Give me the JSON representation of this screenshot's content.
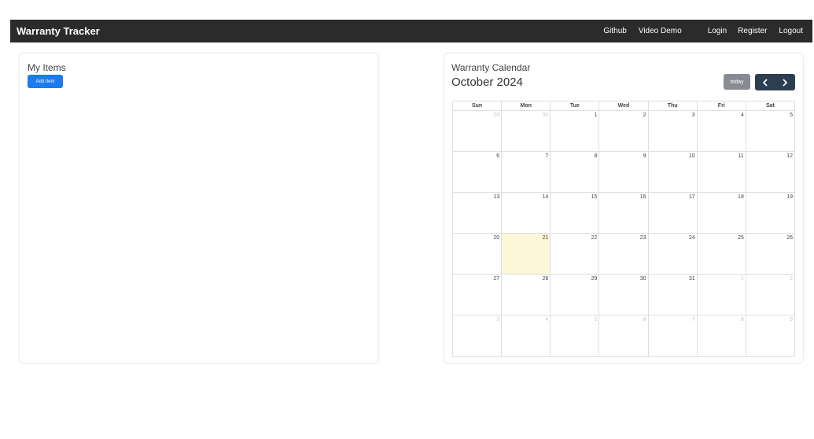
{
  "navbar": {
    "brand": "Warranty Tracker",
    "links": [
      "Github",
      "Video Demo",
      "Login",
      "Register",
      "Logout"
    ]
  },
  "items_panel": {
    "title": "My Items",
    "add_button": "Add Item"
  },
  "calendar": {
    "title": "Warranty Calendar",
    "month": "October 2024",
    "today_button": "today",
    "prev_icon": "chevron-left-icon",
    "next_icon": "chevron-right-icon",
    "days_of_week": [
      "Sun",
      "Mon",
      "Tue",
      "Wed",
      "Thu",
      "Fri",
      "Sat"
    ],
    "weeks": [
      [
        "29",
        "30",
        "1",
        "2",
        "3",
        "4",
        "5"
      ],
      [
        "6",
        "7",
        "8",
        "9",
        "10",
        "11",
        "12"
      ],
      [
        "13",
        "14",
        "15",
        "16",
        "17",
        "18",
        "19"
      ],
      [
        "20",
        "21",
        "22",
        "23",
        "24",
        "25",
        "26"
      ],
      [
        "27",
        "28",
        "29",
        "30",
        "31",
        "1",
        "2"
      ],
      [
        "3",
        "4",
        "5",
        "6",
        "7",
        "8",
        "9"
      ]
    ],
    "today": "21",
    "colors": {
      "today_highlight": "#fcf7d9",
      "nav_buttons": "#2c3e50",
      "today_button": "#878c93",
      "add_button": "#1a7cf0"
    }
  }
}
